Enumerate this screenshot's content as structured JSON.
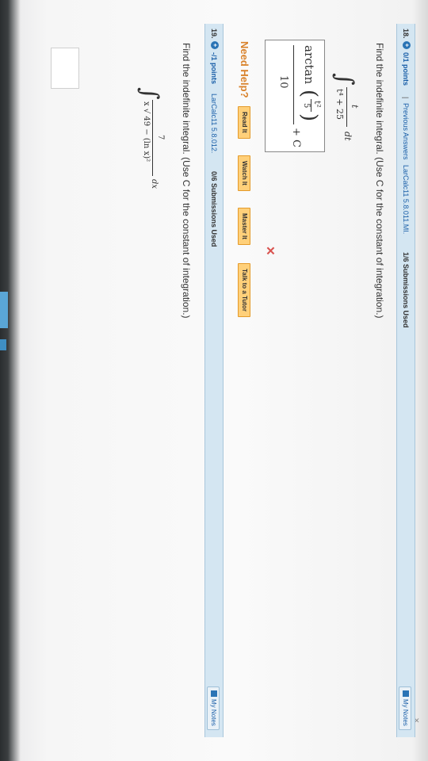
{
  "q18": {
    "number": "18.",
    "score": "0/1 points",
    "separator": "|",
    "previous_answers": "Previous Answers",
    "source": "LarCalc11 5.8.011.MI.",
    "submissions": "1/6 Submissions Used",
    "my_notes": "My Notes",
    "prompt": "Find the indefinite integral. (Use C for the constant of integration.)",
    "integral": {
      "sign": "∫",
      "numerator": "t",
      "denominator": "t⁴ + 25",
      "dvar": "dt"
    },
    "answer": {
      "func": "arctan",
      "inner_num": "t²",
      "inner_den": "5",
      "den": "10",
      "constant": "+ C"
    },
    "result_icon": "x-mark-icon",
    "need_help": "Need Help?",
    "buttons": {
      "read": "Read It",
      "watch": "Watch It",
      "master": "Master It",
      "tutor": "Talk to a Tutor"
    }
  },
  "q19": {
    "number": "19.",
    "score": "-/1 points",
    "source": "LarCalc11 5.8.012.",
    "submissions": "0/6 Submissions Used",
    "my_notes": "My Notes",
    "prompt": "Find the indefinite integral. (Use C for the constant of integration.)",
    "integral": {
      "sign": "∫",
      "numerator": "7",
      "denominator": "x √ 49 − (ln x)²",
      "dvar": "dx"
    }
  },
  "colors": {
    "header_bg": "#d4e6f2",
    "link": "#1a5fa8",
    "help_orange": "#d9822b",
    "button_bg": "#ffd07a",
    "error_red": "#d9534f"
  }
}
